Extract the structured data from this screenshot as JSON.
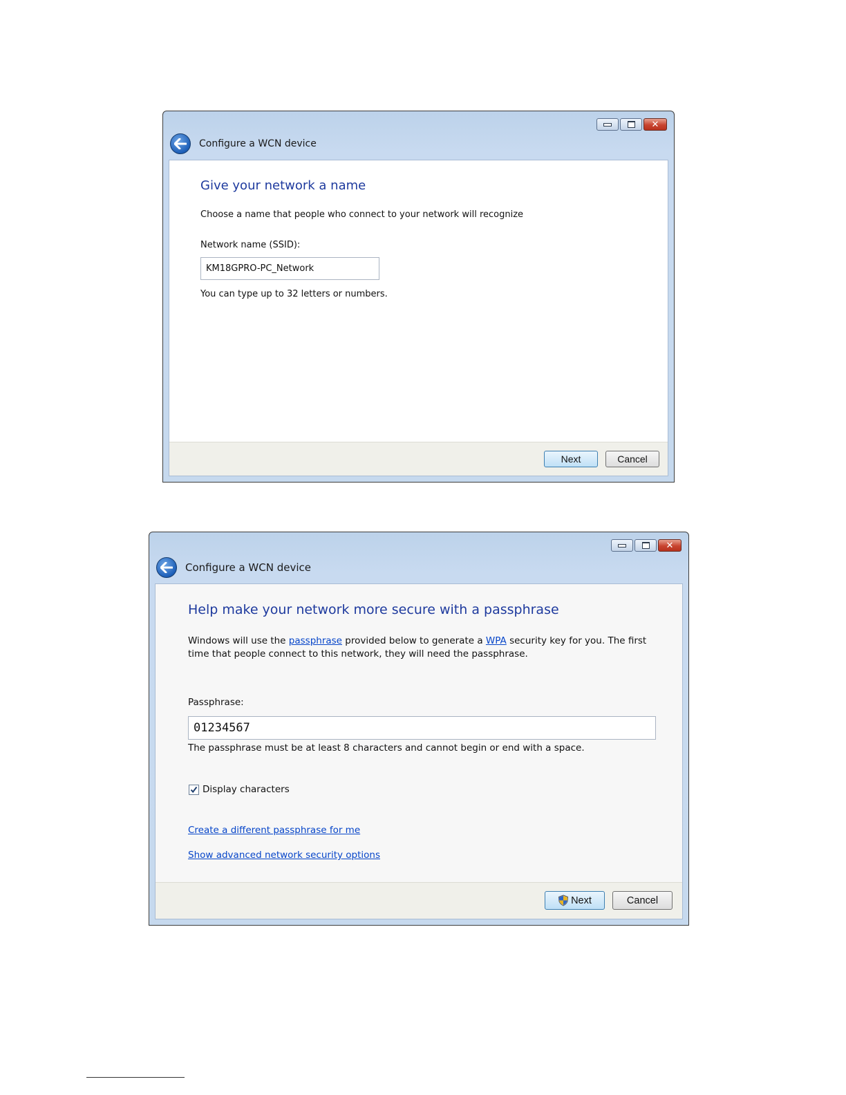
{
  "window1": {
    "title": "Configure a WCN device",
    "heading": "Give your network a name",
    "description": "Choose a name that people who connect to your network will recognize",
    "ssid_label": "Network name (SSID):",
    "ssid_value": "KM18GPRO-PC_Network",
    "hint": "You can type up to 32 letters or numbers.",
    "next_label": "Next",
    "cancel_label": "Cancel"
  },
  "window2": {
    "title": "Configure a WCN device",
    "heading": "Help make your network more secure with a passphrase",
    "desc_part1": "Windows will use the ",
    "desc_link_passphrase": "passphrase",
    "desc_part2": " provided below to generate a ",
    "desc_link_wpa": "WPA",
    "desc_part3": " security key for you. The first",
    "desc_line2": "time that people connect to this network, they will need the passphrase.",
    "passphrase_label": "Passphrase:",
    "passphrase_value": "01234567",
    "passphrase_hint": "The passphrase must be at least 8 characters and cannot begin or end with a space.",
    "display_characters_label": "Display characters",
    "display_characters_checked": true,
    "create_link": "Create a different passphrase for me",
    "advanced_link": "Show advanced network security options",
    "next_label": "Next",
    "cancel_label": "Cancel"
  },
  "colors": {
    "heading": "#1e3a9e",
    "link": "#0645c9",
    "title_bar": "#c8daf0"
  },
  "icons": [
    "back-arrow-icon",
    "minimize-icon",
    "maximize-icon",
    "close-icon",
    "checkmark-icon",
    "uac-shield-icon"
  ]
}
